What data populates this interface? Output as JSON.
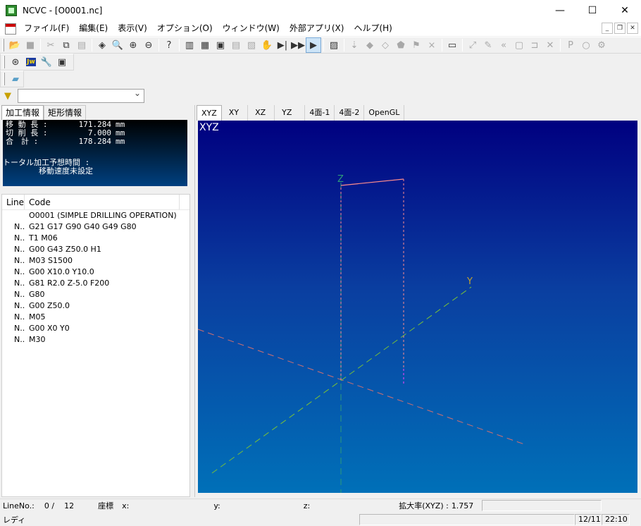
{
  "window": {
    "title": "NCVC - [O0001.nc]",
    "minimize": "—",
    "maximize": "☐",
    "close": "✕"
  },
  "menu": {
    "items": [
      "ファイル(F)",
      "編集(E)",
      "表示(V)",
      "オプション(O)",
      "ウィンドウ(W)",
      "外部アプリ(X)",
      "ヘルプ(H)"
    ],
    "mdi_min": "_",
    "mdi_restore": "❐",
    "mdi_close": "✕"
  },
  "toolbar2": {
    "jw_label": "Jw"
  },
  "info_tabs": [
    "加工情報",
    "矩形情報"
  ],
  "info": {
    "move_label": "移 動 長 :",
    "move_value": "171.284",
    "cut_label": "切 削 長 :",
    "cut_value": "7.000",
    "total_label": "合　計 :",
    "total_value": "178.284",
    "unit": "mm",
    "time_title": "トータル加工予想時間 :",
    "time_value": "移動速度未設定"
  },
  "code_list": {
    "col_line": "Line",
    "col_code": "Code",
    "rows": [
      {
        "line": "",
        "code": "O0001 (SIMPLE DRILLING OPERATION)"
      },
      {
        "line": "N..",
        "code": "G21 G17 G90 G40 G49 G80"
      },
      {
        "line": "N..",
        "code": "T1 M06"
      },
      {
        "line": "N..",
        "code": "G00 G43 Z50.0 H1"
      },
      {
        "line": "N..",
        "code": "M03 S1500"
      },
      {
        "line": "N..",
        "code": "G00 X10.0 Y10.0"
      },
      {
        "line": "N..",
        "code": "G81 R2.0 Z-5.0 F200"
      },
      {
        "line": "N..",
        "code": "G80"
      },
      {
        "line": "N..",
        "code": "G00 Z50.0"
      },
      {
        "line": "N..",
        "code": "M05"
      },
      {
        "line": "N..",
        "code": "G00 X0 Y0"
      },
      {
        "line": "N..",
        "code": "M30"
      }
    ]
  },
  "view": {
    "tabs": [
      "XYZ",
      "XY",
      "XZ",
      "YZ",
      "4面-1",
      "4面-2",
      "OpenGL"
    ],
    "label": "XYZ",
    "axis_z": "Z",
    "axis_y": "Y"
  },
  "status": {
    "line_label": "LineNo.:",
    "line_current": "0 /",
    "line_total": "12",
    "coord_label": "座標",
    "x_label": "x:",
    "y_label": "y:",
    "z_label": "z:",
    "zoom_label": "拡大率(XYZ) :",
    "zoom_value": "1.757",
    "ready": "レディ",
    "date": "12/11",
    "time": "22:10"
  },
  "colors": {
    "view_top": "#000080",
    "view_bottom": "#0070b8",
    "toolpath_rapid": "#ff8c8c",
    "toolpath_cut": "#ff3fff",
    "axis_x": "#d07070",
    "axis_y": "#78c038",
    "axis_z": "#2e9a7a"
  }
}
